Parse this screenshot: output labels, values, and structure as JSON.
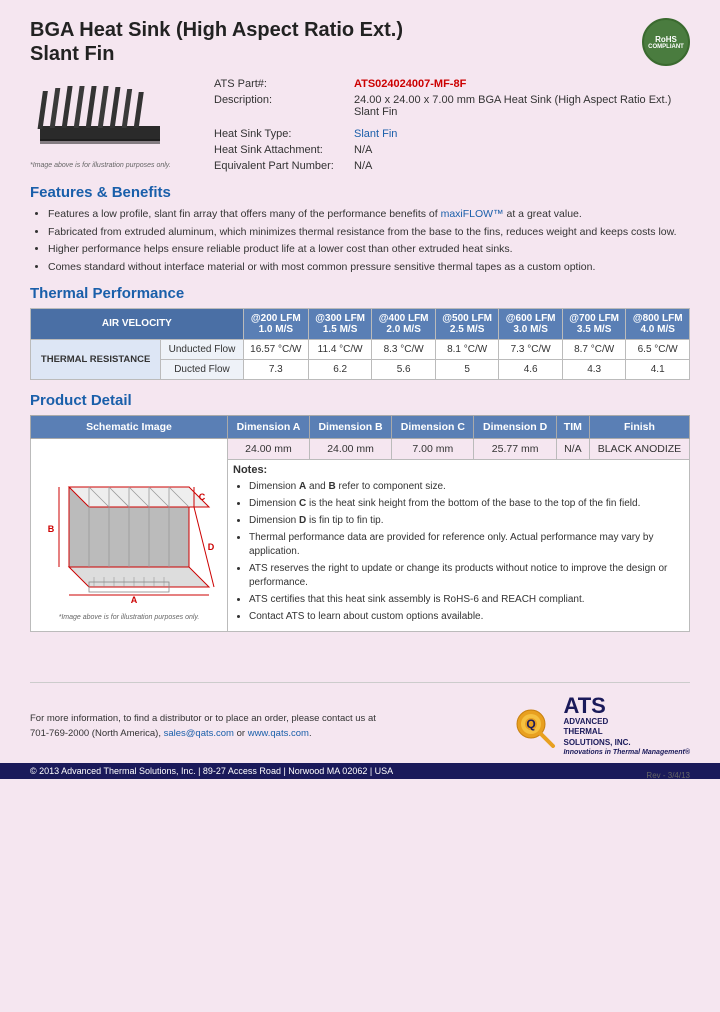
{
  "header": {
    "title_line1": "BGA Heat Sink (High Aspect Ratio Ext.)",
    "title_line2": "Slant Fin",
    "rohs": "RoHS\nCOMPLIANT"
  },
  "product": {
    "part_label": "ATS Part#:",
    "part_number": "ATS024024007-MF-8F",
    "description_label": "Description:",
    "description": "24.00 x 24.00 x 7.00 mm BGA Heat Sink (High Aspect Ratio Ext.) Slant Fin",
    "type_label": "Heat Sink Type:",
    "type_value": "Slant Fin",
    "attachment_label": "Heat Sink Attachment:",
    "attachment_value": "N/A",
    "equiv_label": "Equivalent Part Number:",
    "equiv_value": "N/A",
    "img_caption": "*Image above is for illustration purposes only."
  },
  "features": {
    "section_title": "Features & Benefits",
    "items": [
      "Features a low profile, slant fin array that offers many of the performance benefits of maxiFLOW™ at a great value.",
      "Fabricated from extruded aluminum, which minimizes thermal resistance from the base to the fins, reduces weight and keeps costs low.",
      "Higher performance helps ensure reliable product life at a lower cost than other extruded heat sinks.",
      "Comes standard without interface material or with most common pressure sensitive thermal tapes as a custom option."
    ],
    "maxiflow_link": "maxiFLOW™"
  },
  "thermal_performance": {
    "section_title": "Thermal Performance",
    "table": {
      "header_col1": "AIR VELOCITY",
      "columns": [
        "@200 LFM\n1.0 M/S",
        "@300 LFM\n1.5 M/S",
        "@400 LFM\n2.0 M/S",
        "@500 LFM\n2.5 M/S",
        "@600 LFM\n3.0 M/S",
        "@700 LFM\n3.5 M/S",
        "@800 LFM\n4.0 M/S"
      ],
      "row_label": "THERMAL RESISTANCE",
      "rows": [
        {
          "sub_label": "Unducted Flow",
          "values": [
            "16.57 °C/W",
            "11.4 °C/W",
            "8.3 °C/W",
            "8.1 °C/W",
            "7.3 °C/W",
            "8.7 °C/W",
            "6.5 °C/W"
          ]
        },
        {
          "sub_label": "Ducted Flow",
          "values": [
            "7.3",
            "6.2",
            "5.6",
            "5",
            "4.6",
            "4.3",
            "4.1"
          ]
        }
      ]
    }
  },
  "product_detail": {
    "section_title": "Product Detail",
    "table_headers": [
      "Schematic Image",
      "Dimension A",
      "Dimension B",
      "Dimension C",
      "Dimension D",
      "TIM",
      "Finish"
    ],
    "dimension_values": [
      "24.00 mm",
      "24.00 mm",
      "7.00 mm",
      "25.77 mm",
      "N/A",
      "BLACK ANODIZE"
    ],
    "notes_label": "Notes:",
    "notes": [
      "Dimension A and B refer to component size.",
      "Dimension C is the heat sink height from the bottom of the base to the top of the fin field.",
      "Dimension D is fin tip to fin tip.",
      "Thermal performance data are provided for reference only. Actual performance may vary by application.",
      "ATS reserves the right to update or change its products without notice to improve the design or performance.",
      "ATS certifies that this heat sink assembly is RoHS-6 and REACH compliant.",
      "Contact ATS to learn about custom options available."
    ],
    "schematic_caption": "*Image above is for illustration purposes only."
  },
  "footer": {
    "contact_text": "For more information, to find a distributor or to place an order, please contact us at\n701-769-2000 (North America),",
    "email": "sales@qats.com",
    "or_text": "or",
    "website": "www.qats.com",
    "copyright": "© 2013 Advanced Thermal Solutions, Inc.  |  89-27 Access Road  |  Norwood MA  02062  |  USA",
    "ats_name": "ADVANCED\nTHERMAL\nSOLUTIONS, INC.",
    "ats_tagline": "Innovations in Thermal Management®",
    "page_num": "Rev - 3/4/13"
  }
}
